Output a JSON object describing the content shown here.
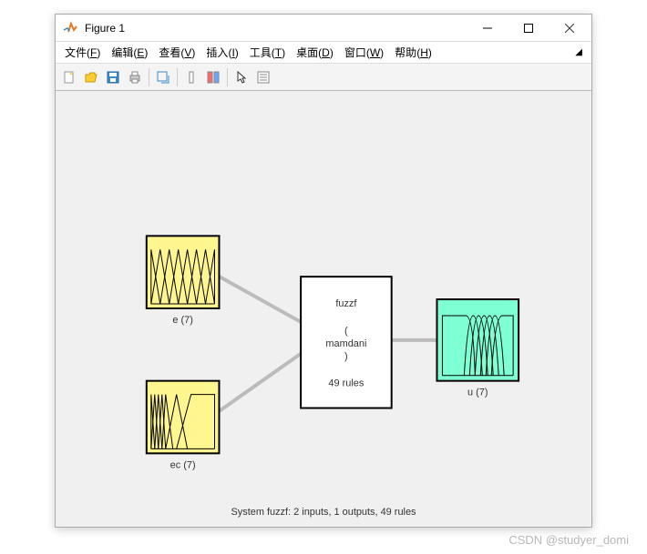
{
  "window": {
    "title": "Figure 1"
  },
  "menubar": {
    "file": "文件",
    "file_m": "F",
    "edit": "编辑",
    "edit_m": "E",
    "view": "查看",
    "view_m": "V",
    "insert": "插入",
    "insert_m": "I",
    "tools": "工具",
    "tools_m": "T",
    "desktop": "桌面",
    "desktop_m": "D",
    "window": "窗口",
    "window_m": "W",
    "help": "帮助",
    "help_m": "H"
  },
  "diagram": {
    "input1_label": "e (7)",
    "input2_label": "ec (7)",
    "output_label": "u (7)",
    "center_name": "fuzzf",
    "center_open": "(",
    "center_type": "mamdani",
    "center_close": ")",
    "center_rules": "49 rules",
    "footer": "System fuzzf: 2 inputs, 1 outputs, 49 rules"
  },
  "watermark": "CSDN @studyer_domi",
  "chart_data": {
    "type": "diagram",
    "title": "Fuzzy Inference System structure",
    "system_name": "fuzzf",
    "system_type": "mamdani",
    "inputs": [
      {
        "name": "e",
        "mf_count": 7
      },
      {
        "name": "ec",
        "mf_count": 7
      }
    ],
    "outputs": [
      {
        "name": "u",
        "mf_count": 7
      }
    ],
    "rules": 49,
    "footer": "System fuzzf: 2 inputs, 1 outputs, 49 rules"
  }
}
